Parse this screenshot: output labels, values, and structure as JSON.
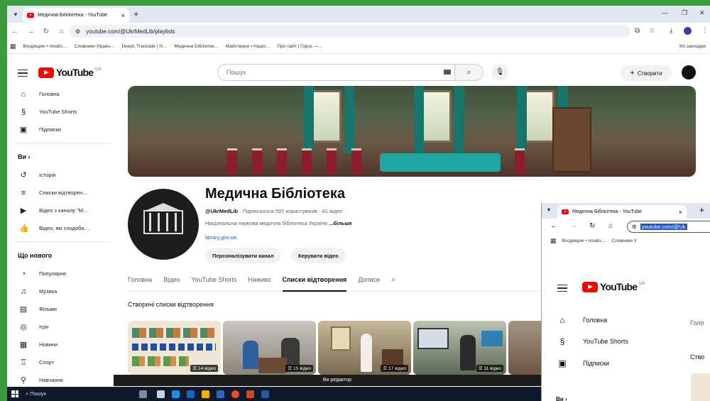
{
  "browser": {
    "tab_title": "Медична Бібліотека - YouTube",
    "url": "youtube.com/@UkrMedLib/playlists",
    "bookmarks": [
      "Входящие • nmalis…",
      "Словники Україн…",
      "DeepL Translate | H…",
      "Медична Бібліотек…",
      "Майстерня • Націо…",
      "Про сайт | Горох —…"
    ],
    "all_bookmarks": "Усі закладки"
  },
  "youtube": {
    "logo": "YouTube",
    "region": "UA",
    "search_placeholder": "Пошук",
    "create_label": "Створити"
  },
  "sidebar": {
    "main": [
      {
        "label": "Головна",
        "icon": "home-icon"
      },
      {
        "label": "YouTube Shorts",
        "icon": "shorts-icon"
      },
      {
        "label": "Підписки",
        "icon": "subscriptions-icon"
      }
    ],
    "you_heading": "Ви",
    "you": [
      {
        "label": "Історія",
        "icon": "history-icon"
      },
      {
        "label": "Списки відтворен…",
        "icon": "playlists-icon"
      },
      {
        "label": "Відео з каналу \"М…",
        "icon": "your-videos-icon"
      },
      {
        "label": "Відео, які сподоба…",
        "icon": "liked-icon"
      }
    ],
    "new_heading": "Що нового",
    "explore": [
      {
        "label": "Популярне",
        "icon": "trending-icon"
      },
      {
        "label": "Музика",
        "icon": "music-icon"
      },
      {
        "label": "Фільми",
        "icon": "movies-icon"
      },
      {
        "label": "Ігри",
        "icon": "gaming-icon"
      },
      {
        "label": "Новини",
        "icon": "news-icon"
      },
      {
        "label": "Спорт",
        "icon": "sport-icon"
      },
      {
        "label": "Навчання",
        "icon": "learning-icon"
      }
    ]
  },
  "channel": {
    "name": "Медична Бібліотека",
    "handle": "@UkrMedLib",
    "stats": "· Підписалося 597 користувачів · 91 відео",
    "description": "Національна наукова медична бібліотека України",
    "more": "...більше",
    "link": "library.gov.ua",
    "customize_button": "Персоналізувати канал",
    "manage_button": "Керувати відео",
    "tabs": [
      "Головна",
      "Відео",
      "YouTube Shorts",
      "Наживо",
      "Списки відтворення",
      "Дописи"
    ],
    "active_tab": "Списки відтворення",
    "section_title": "Створені списки відтворення",
    "playlists": [
      {
        "count": "14 відео"
      },
      {
        "count": "15 відео"
      },
      {
        "count": "17 відео"
      },
      {
        "count": "11 відео"
      }
    ],
    "tooltip": "Ви редактор"
  },
  "taskbar": {
    "search": "Пошук"
  },
  "second_window": {
    "tab_title": "Медична Бібліотека - YouTube",
    "url": "youtube.com/@Uk",
    "bookmark": "Входящие • nmalis…",
    "bookmark2": "Словники У",
    "items": [
      "Головна",
      "YouTube Shorts",
      "Підписки"
    ],
    "you_heading": "Ви",
    "right_tab": "Голо",
    "right_section": "Ство"
  }
}
